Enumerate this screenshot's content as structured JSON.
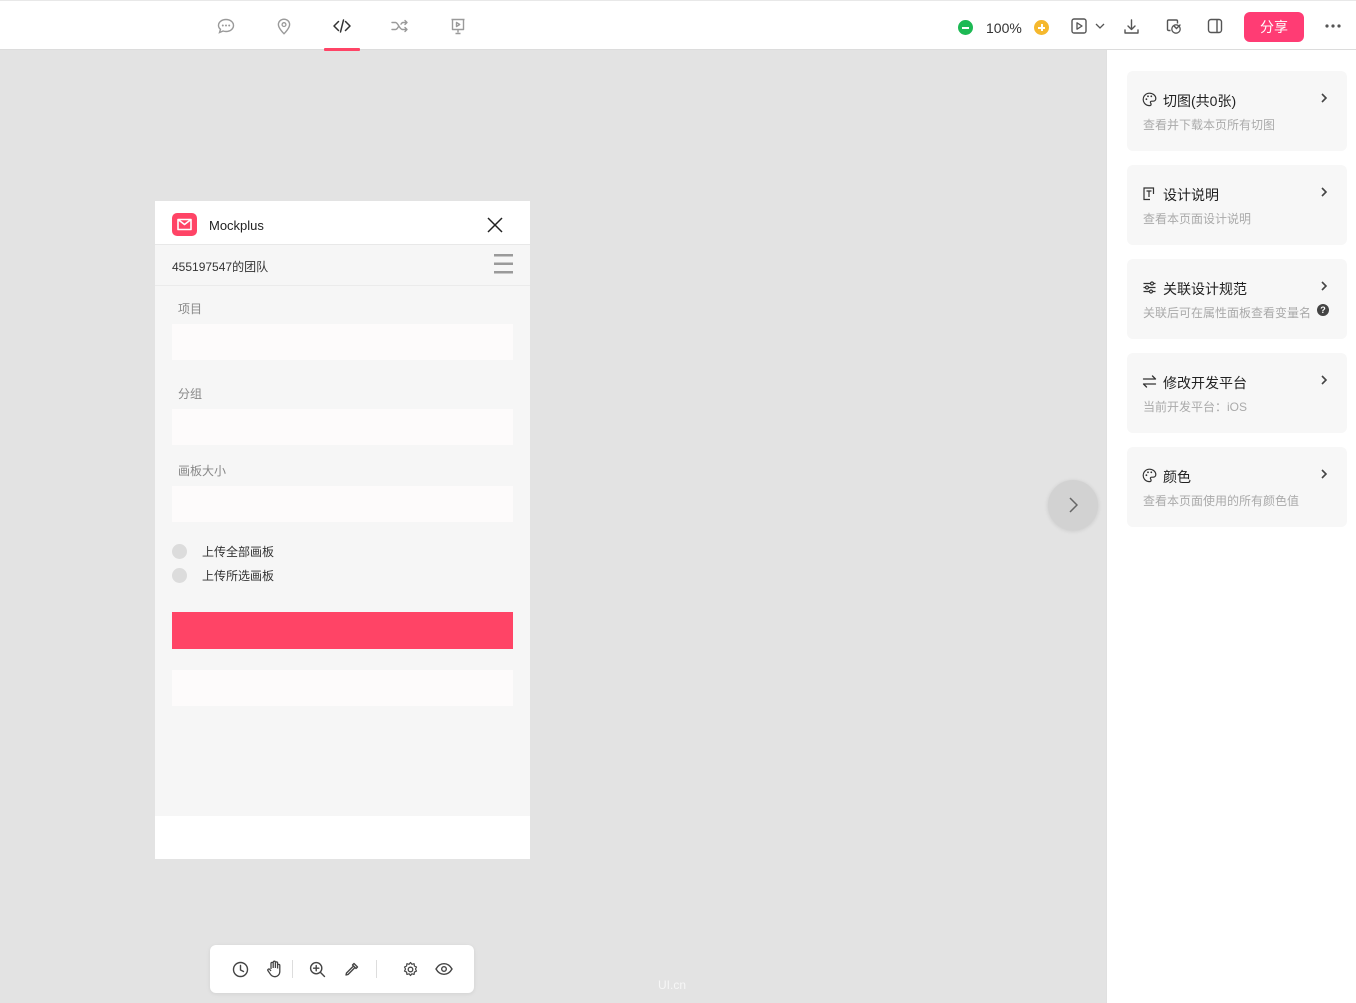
{
  "toolbar": {
    "tabs": [
      {
        "name": "comment-tab",
        "icon": "comment-icon"
      },
      {
        "name": "annotation-tab",
        "icon": "location-pin-icon"
      },
      {
        "name": "code-tab",
        "icon": "code-icon",
        "active": true
      },
      {
        "name": "flow-tab",
        "icon": "shuffle-icon"
      },
      {
        "name": "present-tab",
        "icon": "presentation-icon"
      }
    ],
    "zoom": "100%",
    "share_label": "分享",
    "accent_color": "#ff3c74"
  },
  "artboard": {
    "app_name": "Mockplus",
    "team_name": "455197547的团队",
    "project_label": "项目",
    "group_label": "分组",
    "board_size_label": "画板大小",
    "radio_upload_all": "上传全部画板",
    "radio_upload_selected": "上传所选画板",
    "primary_color": "#ff4466"
  },
  "right_panel": {
    "cards": [
      {
        "title": "切图(共0张)",
        "desc": "查看并下载本页所有切图",
        "icon": "palette-icon"
      },
      {
        "title": "设计说明",
        "desc": "查看本页面设计说明",
        "icon": "text-doc-icon"
      },
      {
        "title": "关联设计规范",
        "desc": "关联后可在属性面板查看变量名",
        "icon": "sliders-icon"
      },
      {
        "title": "修改开发平台",
        "desc": "当前开发平台：iOS",
        "icon": "swap-icon"
      },
      {
        "title": "颜色",
        "desc": "查看本页面使用的所有颜色值",
        "icon": "palette-icon"
      }
    ]
  },
  "watermark": "UI.cn"
}
